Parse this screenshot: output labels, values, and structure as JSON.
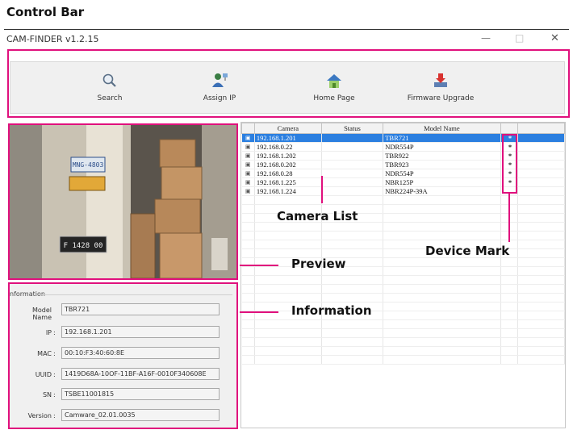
{
  "figure_title": "Control Bar",
  "window": {
    "title": "CAM-FINDER v1.2.15",
    "minimize": "—",
    "maximize": "□",
    "close": "✕"
  },
  "toolbar": {
    "items": [
      {
        "label": "Search",
        "icon": "magnifier-icon"
      },
      {
        "label": "Assign IP",
        "icon": "user-network-icon"
      },
      {
        "label": "Home Page",
        "icon": "house-icon"
      },
      {
        "label": "Firmware Upgrade",
        "icon": "download-arrow-icon"
      }
    ]
  },
  "information": {
    "legend": "nformation",
    "fields": [
      {
        "label": "Model Name",
        "value": "TBR721"
      },
      {
        "label": "IP",
        "value": "192.168.1.201"
      },
      {
        "label": "MAC",
        "value": "00:10:F3:40:60:8E"
      },
      {
        "label": "UUID",
        "value": "1419D68A-10OF-11BF-A16F-0010F340608E"
      },
      {
        "label": "SN",
        "value": "TSBE11001815"
      },
      {
        "label": "Version",
        "value": "Camware_02.01.0035"
      }
    ]
  },
  "camera_list": {
    "columns": [
      "",
      "Camera",
      "Status",
      "Model Name",
      "",
      ""
    ],
    "rows": [
      {
        "camera": "192.168.1.201",
        "status": "",
        "model": "TBR721",
        "mark": "*",
        "selected": true
      },
      {
        "camera": "192.168.0.22",
        "status": "",
        "model": "NDR554P",
        "mark": "*",
        "selected": false
      },
      {
        "camera": "192.168.1.202",
        "status": "",
        "model": "TBR922",
        "mark": "*",
        "selected": false
      },
      {
        "camera": "192.168.0.202",
        "status": "",
        "model": "TBR923",
        "mark": "*",
        "selected": false
      },
      {
        "camera": "192.168.0.28",
        "status": "",
        "model": "NDR554P",
        "mark": "*",
        "selected": false
      },
      {
        "camera": "192.168.1.225",
        "status": "",
        "model": "NBR125P",
        "mark": "*",
        "selected": false
      },
      {
        "camera": "192.168.1.224",
        "status": "",
        "model": "NBR224P-39A",
        "mark": "",
        "selected": false
      }
    ],
    "empty_rows": 19
  },
  "annotations": {
    "camera_list": "Camera List",
    "device_mark": "Device Mark",
    "preview": "Preview",
    "information": "Information"
  },
  "preview": {
    "plate_1": "MNG-4803",
    "plate_2": "F 1428 00"
  },
  "colors": {
    "highlight": "#e0107d",
    "selection": "#2b7fe0",
    "toolbar_bg": "#f0f0f0"
  }
}
